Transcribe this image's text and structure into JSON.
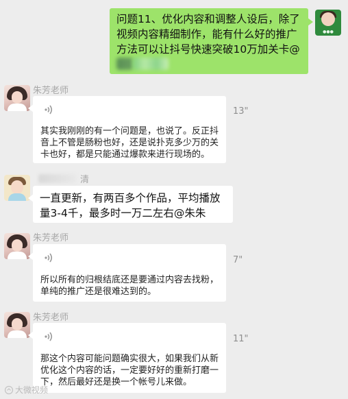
{
  "messages": [
    {
      "id": "out-1",
      "direction": "outgoing",
      "text": "问题11、优化内容和调整人设后，除了视频内容精细制作，能有什么好的推广方法可以让抖号快速突破10万加关卡@"
    },
    {
      "id": "in-voice-1",
      "sender": "朱芳老师",
      "type": "voice",
      "duration": "13\"",
      "transcript": "其实我刚刚的有一个问题是，也说了。反正抖音上不管是肠粉也好，还是说扑克多少万的关卡也好，都是只能通过爆款来进行现场的。"
    },
    {
      "id": "in-text-1",
      "sender_suffix": "清",
      "type": "text",
      "text": "一直更新，有两百多个作品，平均播放量3-4千，最多时一万二左右@朱朱"
    },
    {
      "id": "in-voice-2",
      "sender": "朱芳老师",
      "type": "voice",
      "duration": "7\"",
      "transcript": "所以所有的归根结底还是要通过内容去找粉，单纯的推广还是很难达到的。"
    },
    {
      "id": "in-voice-3",
      "sender": "朱芳老师",
      "type": "voice",
      "duration": "11\"",
      "transcript": "那这个内容可能问题确实很大，如果我们从新优化这个内容的话，一定要好好的重新打磨一下，然后最好还是换一个帐号儿来做。"
    }
  ],
  "watermark": "大微视频",
  "colors": {
    "background": "#ededed",
    "outgoing_bubble": "#9de36a",
    "incoming_bubble": "#ffffff",
    "sender_name": "#a7a7a7",
    "duration": "#8e8e8e"
  },
  "icons": [
    "voice-icon",
    "avatar",
    "watermark-icon"
  ]
}
